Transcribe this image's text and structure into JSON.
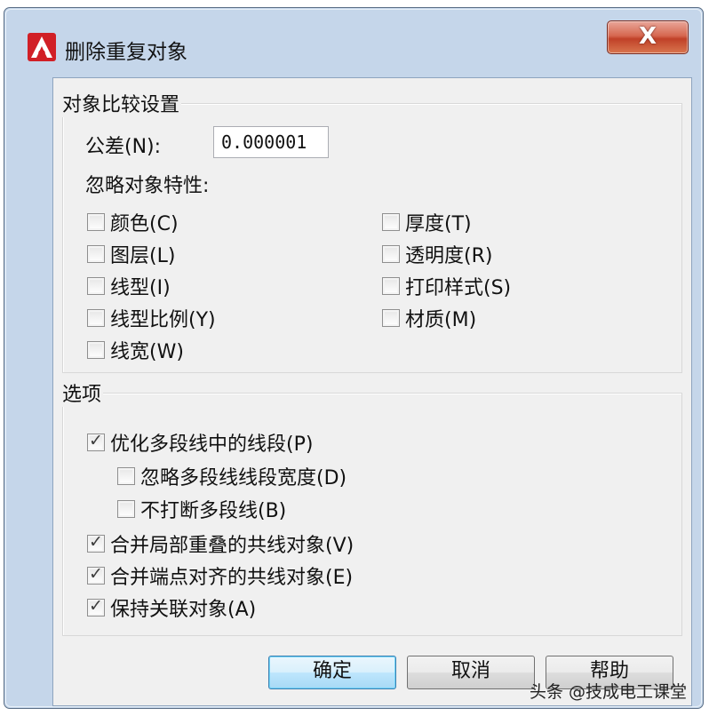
{
  "window": {
    "title": "删除重复对象",
    "close_label": "X"
  },
  "compare_group": {
    "legend": "对象比较设置",
    "tolerance_label": "公差(N):",
    "tolerance_value": "0.000001",
    "ignore_label": "忽略对象特性:",
    "properties": [
      {
        "label": "颜色(C)",
        "checked": false
      },
      {
        "label": "图层(L)",
        "checked": false
      },
      {
        "label": "线型(I)",
        "checked": false
      },
      {
        "label": "线型比例(Y)",
        "checked": false
      },
      {
        "label": "线宽(W)",
        "checked": false
      },
      {
        "label": "厚度(T)",
        "checked": false
      },
      {
        "label": "透明度(R)",
        "checked": false
      },
      {
        "label": "打印样式(S)",
        "checked": false
      },
      {
        "label": "材质(M)",
        "checked": false
      }
    ]
  },
  "options_group": {
    "legend": "选项",
    "items": [
      {
        "label": "优化多段线中的线段(P)",
        "checked": true
      },
      {
        "label": "忽略多段线线段宽度(D)",
        "checked": false
      },
      {
        "label": "不打断多段线(B)",
        "checked": false
      },
      {
        "label": "合并局部重叠的共线对象(V)",
        "checked": true
      },
      {
        "label": "合并端点对齐的共线对象(E)",
        "checked": true
      },
      {
        "label": "保持关联对象(A)",
        "checked": true
      }
    ]
  },
  "buttons": {
    "ok": "确定",
    "cancel": "取消",
    "help": "帮助"
  },
  "watermark": "头条 @技成电工课堂",
  "colors": {
    "frame": "#c5d6ea",
    "client": "#f0f0f0",
    "close_button": "#c94a32",
    "default_button": "#bee6fd",
    "app_icon": "#d11f26"
  }
}
